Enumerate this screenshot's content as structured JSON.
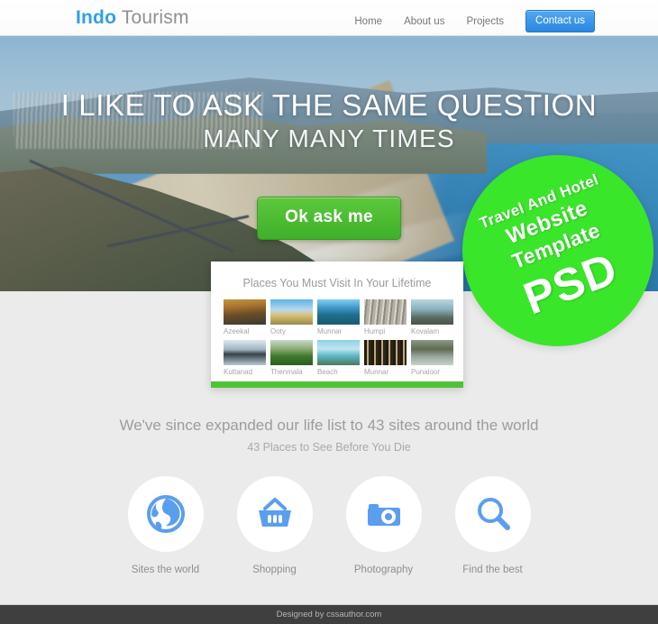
{
  "header": {
    "logo_primary": "Indo",
    "logo_secondary": " Tourism",
    "nav": [
      {
        "label": "Home"
      },
      {
        "label": "About us"
      },
      {
        "label": "Projects"
      }
    ],
    "cta_label": "Contact us",
    "accent_color": "#2f9fe8"
  },
  "hero": {
    "title": "I LIKE TO ASK THE SAME QUESTION",
    "subtitle": "MANY MANY TIMES",
    "button_label": "Ok ask me",
    "button_color": "#4bbd2d"
  },
  "badge": {
    "line1": "Travel And Hotel",
    "line2": "Website",
    "line3": "Template",
    "line4": "PSD",
    "color": "#3ae62a"
  },
  "card": {
    "title": "Places You Must Visit In Your Lifetime",
    "accent_color": "#4fc236",
    "rows": [
      [
        {
          "label": "Azeekal",
          "thumb": "t-azeekal"
        },
        {
          "label": "Ooty",
          "thumb": "t-ooty"
        },
        {
          "label": "Munnar",
          "thumb": "t-munnar"
        },
        {
          "label": "Humpi",
          "thumb": "t-humpi"
        },
        {
          "label": "Kovalam",
          "thumb": "t-kovalam"
        }
      ],
      [
        {
          "label": "Kuttanad",
          "thumb": "t-kuttanad"
        },
        {
          "label": "Thenmala",
          "thumb": "t-thenmala"
        },
        {
          "label": "Beach",
          "thumb": "t-beach"
        },
        {
          "label": "Munnar",
          "thumb": "t-munnar2"
        },
        {
          "label": "Punaloor",
          "thumb": "t-punaloor"
        }
      ]
    ]
  },
  "mid": {
    "heading": "We've since expanded our life list to 43 sites around the world",
    "subheading": "43 Places to See Before You Die"
  },
  "features": [
    {
      "label": "Sites the world",
      "icon": "globe-icon"
    },
    {
      "label": "Shopping",
      "icon": "basket-icon"
    },
    {
      "label": "Photography",
      "icon": "camera-icon"
    },
    {
      "label": "Find the best",
      "icon": "magnifier-icon"
    }
  ],
  "features_icon_color": "#5a9ef0",
  "footer": {
    "text": "Designed by cssauthor.com"
  }
}
